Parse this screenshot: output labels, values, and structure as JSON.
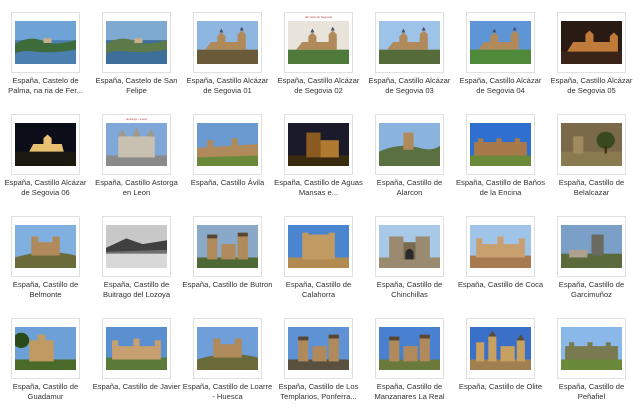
{
  "items": [
    {
      "label": "España, Castelo de Palma, na ria de Fer...",
      "sky": "#6fa3d6",
      "ground": "#3d6b3a",
      "water": "#4a7fb0",
      "shape": "coast"
    },
    {
      "label": "España, Castelo de San Felipe",
      "sky": "#7ea9d0",
      "ground": "#5c7a4a",
      "water": "#3e6f9a",
      "shape": "coast"
    },
    {
      "label": "España, Castillo Alcázar de Segovia 01",
      "sky": "#8fb6e0",
      "ground": "#6a5a3a",
      "shape": "alcazar"
    },
    {
      "label": "España, Castillo Alcázar de Segovia 02",
      "sky": "#e8e4dc",
      "ground": "#4f7a3a",
      "shape": "alcazar",
      "overlay": "Alcazar de Segovia"
    },
    {
      "label": "España, Castillo Alcázar de Segovia 03",
      "sky": "#9ec3e8",
      "ground": "#556b3a",
      "shape": "alcazar"
    },
    {
      "label": "España, Castillo Alcázar de Segovia 04",
      "sky": "#5d95d6",
      "ground": "#4e8a3a",
      "shape": "alcazar-far"
    },
    {
      "label": "España, Castillo Alcázar de Segovia 05",
      "sky": "#2a1a14",
      "ground": "#3a2418",
      "shape": "alcazar-night"
    },
    {
      "label": "España, Castillo Alcázar de Segovia 06",
      "sky": "#0b0d18",
      "ground": "#1a1a10",
      "shape": "night-lit"
    },
    {
      "label": "España, Castillo Astorga en Leon",
      "sky": "#7fa8d8",
      "ground": "#8a8a8a",
      "shape": "palace",
      "overlay": "Astorga - Leon"
    },
    {
      "label": "España, Castillo Ávila",
      "sky": "#6b9ad0",
      "ground": "#8a7048",
      "shape": "walls"
    },
    {
      "label": "España, Castillo de Aguas Mansas e...",
      "sky": "#1a1a2a",
      "ground": "#8a5a20",
      "shape": "tower-lit"
    },
    {
      "label": "España, Castillo de Alarcon",
      "sky": "#8ab4de",
      "ground": "#5a7040",
      "shape": "hilltower"
    },
    {
      "label": "España, Castillo de Baños de la Encina",
      "sky": "#2f6fd0",
      "ground": "#a87a4a",
      "shape": "long-walls"
    },
    {
      "label": "España, Castillo de Belalcazar",
      "sky": "#7a6a4a",
      "ground": "#8a7a50",
      "shape": "ruin-tree"
    },
    {
      "label": "España, Castillo de Belmonte",
      "sky": "#7fb0e0",
      "ground": "#6a6a3a",
      "shape": "hillcastle"
    },
    {
      "label": "España, Castillo de Buitrago del Lozoya",
      "sky": "#c8c8c8",
      "ground": "#404040",
      "shape": "bw-lake"
    },
    {
      "label": "España, Castillo de Butron",
      "sky": "#8aa8c8",
      "ground": "#4e6a34",
      "shape": "towers"
    },
    {
      "label": "España, Castillo de Calahorra",
      "sky": "#4a86d0",
      "ground": "#b08a50",
      "shape": "keep"
    },
    {
      "label": "España, Castillo de Chinchillas",
      "sky": "#a8c8e8",
      "ground": "#9a8a70",
      "shape": "gate"
    },
    {
      "label": "España, Castillo de Coca",
      "sky": "#a0c4e8",
      "ground": "#a87a50",
      "shape": "wide-castle"
    },
    {
      "label": "España, Castillo de Garcimuñoz",
      "sky": "#7aa0c8",
      "ground": "#5a6a3a",
      "shape": "village-castle"
    },
    {
      "label": "España, Castillo de Guadamur",
      "sky": "#6ea0d8",
      "ground": "#4a6a2a",
      "shape": "keep-tree"
    },
    {
      "label": "España, Castillo de Javier",
      "sky": "#5a90d0",
      "ground": "#5a7a3a",
      "shape": "wide-castle"
    },
    {
      "label": "España, Castillo de Loarre - Huesca",
      "sky": "#6e9fd8",
      "ground": "#6a6a3a",
      "shape": "hillcastle"
    },
    {
      "label": "España, Castillo de Los Templarios, Ponferra...",
      "sky": "#5e92d4",
      "ground": "#5a5040",
      "shape": "towers"
    },
    {
      "label": "España, Castillo de Manzanares La Real",
      "sky": "#4a80d0",
      "ground": "#6a7a3a",
      "shape": "towers"
    },
    {
      "label": "España, Castillo de Olite",
      "sky": "#3a70c8",
      "ground": "#a08050",
      "shape": "olite"
    },
    {
      "label": "España, Castillo de Peñafiel",
      "sky": "#8ab8e8",
      "ground": "#7a7a50",
      "shape": "long-walls"
    }
  ]
}
